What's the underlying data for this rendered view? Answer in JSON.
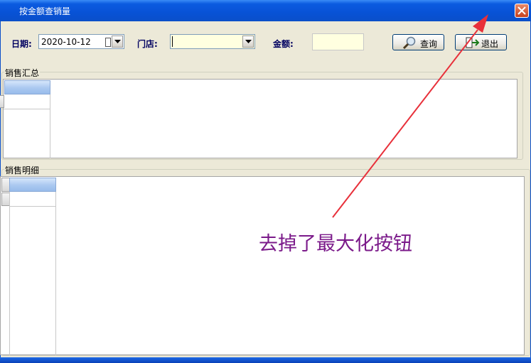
{
  "window": {
    "title": "按金额查销量"
  },
  "filters": {
    "date_label": "日期:",
    "date_value": "2020-10-12",
    "store_label": "门店:",
    "store_value": "",
    "amount_label": "金额:",
    "amount_value": ""
  },
  "toolbar": {
    "query_label": "查询",
    "exit_label": "退出"
  },
  "sections": {
    "summary_title": "销售汇总",
    "detail_title": "销售明细"
  },
  "annotation": {
    "text": "去掉了最大化按钮",
    "color": "#7b1a8a",
    "arrow_color": "#e8303a"
  }
}
